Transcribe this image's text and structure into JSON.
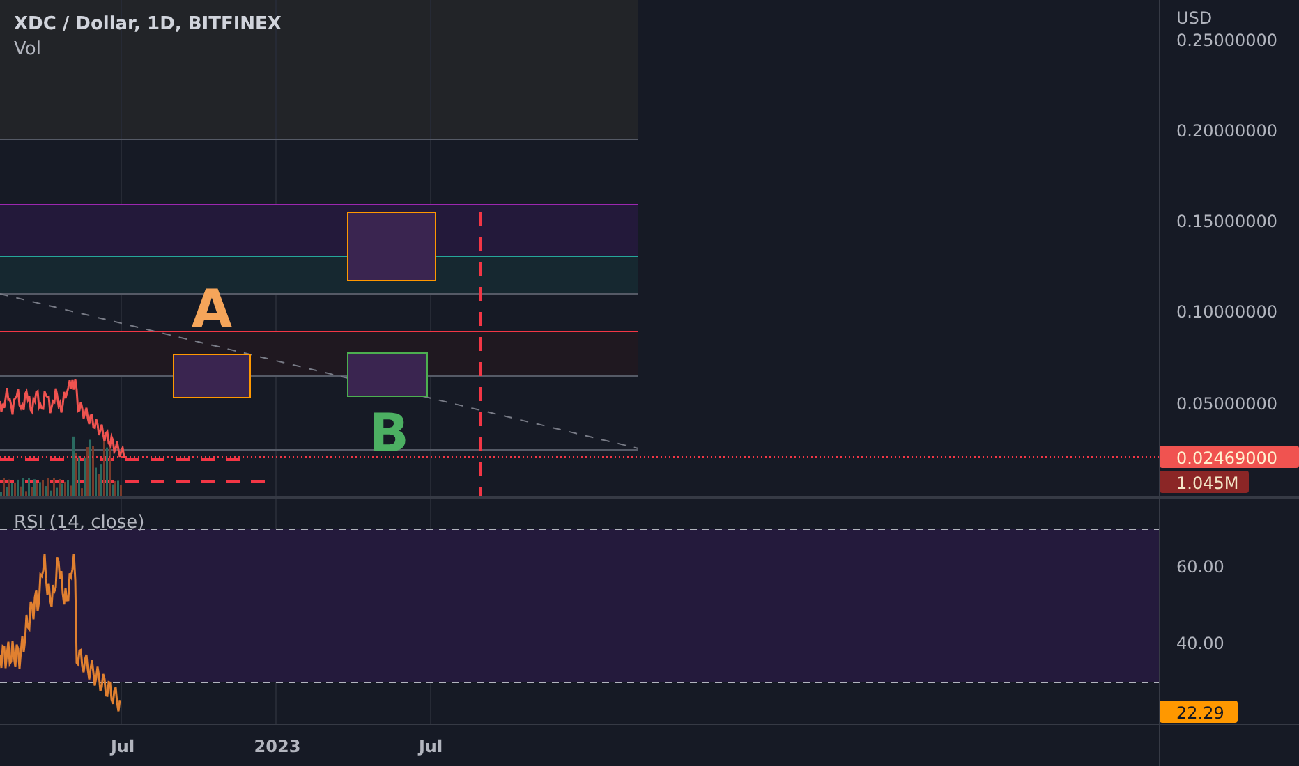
{
  "header": {
    "symbol": "XDC / Dollar, 1D, BITFINEX",
    "volume_label": "Vol"
  },
  "price_axis": {
    "currency": "USD",
    "ticks": [
      "0.25000000",
      "0.20000000",
      "0.15000000",
      "0.10000000",
      "0.05000000"
    ]
  },
  "price_badges": [
    {
      "kind": "last_price",
      "text": "0.02469000"
    },
    {
      "kind": "volume",
      "text": "1.045M"
    }
  ],
  "annotations": [
    {
      "text": "A",
      "color": "#f5a55a"
    },
    {
      "text": "B",
      "color": "#4caf62"
    }
  ],
  "rsi": {
    "label": "RSI (14, close)",
    "ticks": [
      "60.00",
      "40.00"
    ],
    "badge": "22.29"
  },
  "time_axis": [
    "Jul",
    "2023",
    "Jul"
  ]
}
